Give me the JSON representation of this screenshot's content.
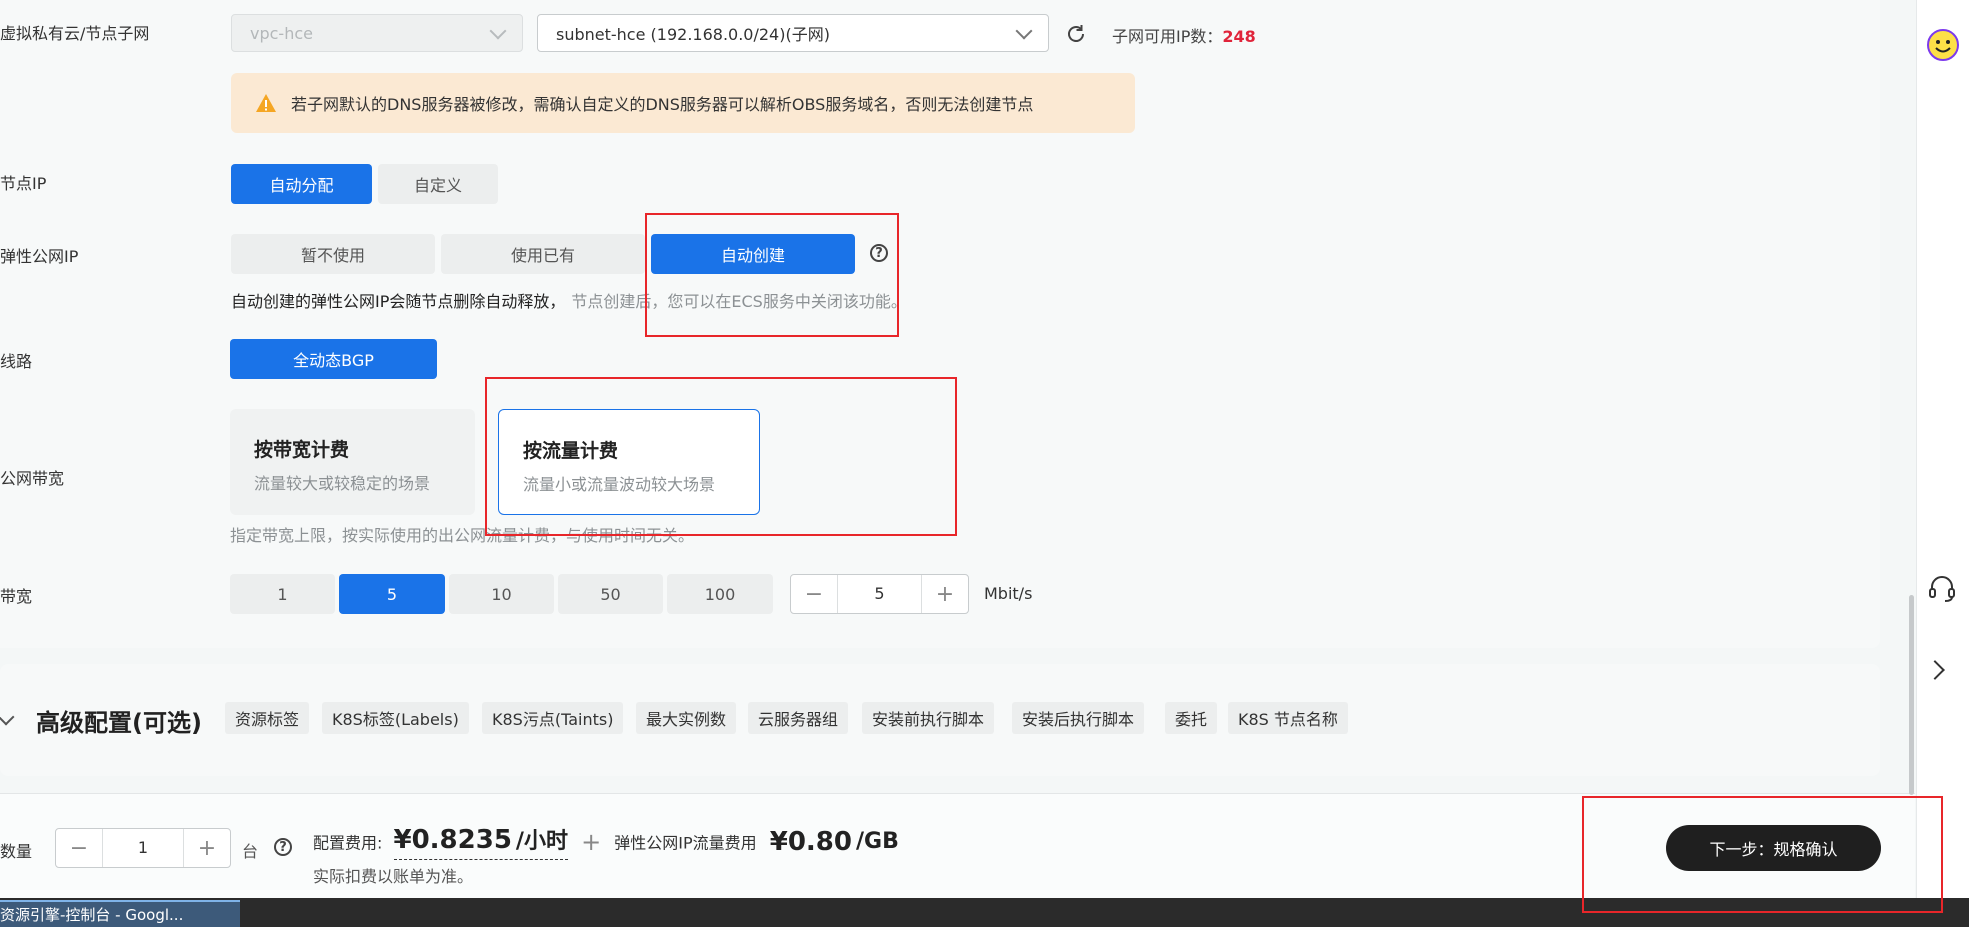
{
  "vpc": {
    "label": "虚拟私有云/节点子网",
    "vpc_value": "vpc-hce",
    "subnet_value": "subnet-hce (192.168.0.0/24)(子网)",
    "available_ip_label": "子网可用IP数：",
    "available_ip_count": "248"
  },
  "dns_warning": "若子网默认的DNS服务器被修改，需确认自定义的DNS服务器可以解析OBS服务域名，否则无法创建节点",
  "node_ip": {
    "label": "节点IP",
    "options": [
      "自动分配",
      "自定义"
    ],
    "selected": "自动分配"
  },
  "eip": {
    "label": "弹性公网IP",
    "options": [
      "暂不使用",
      "使用已有",
      "自动创建"
    ],
    "selected": "自动创建",
    "note_bold": "自动创建的弹性公网IP会随节点删除自动释放，",
    "note_rest": "节点创建后，您可以在ECS服务中关闭该功能。"
  },
  "line": {
    "label": "线路",
    "value": "全动态BGP"
  },
  "billing": {
    "label": "公网带宽",
    "cards": [
      {
        "title": "按带宽计费",
        "desc": "流量较大或较稳定的场景"
      },
      {
        "title": "按流量计费",
        "desc": "流量小或流量波动较大场景"
      }
    ],
    "selected_index": 1,
    "note": "指定带宽上限，按实际使用的出公网流量计费，与使用时间无关。"
  },
  "bandwidth": {
    "label": "带宽",
    "options": [
      "1",
      "5",
      "10",
      "50",
      "100"
    ],
    "selected": "5",
    "value": "5",
    "unit": "Mbit/s"
  },
  "advanced": {
    "title": "高级配置(可选)",
    "tags": [
      "资源标签",
      "K8S标签(Labels)",
      "K8S污点(Taints)",
      "最大实例数",
      "云服务器组",
      "安装前执行脚本",
      "安装后执行脚本",
      "委托",
      "K8S 节点名称"
    ]
  },
  "footer": {
    "quantity_label": "数量",
    "quantity": "1",
    "unit": "台",
    "config_fee_label": "配置费用:",
    "config_fee": "¥0.8235",
    "config_fee_unit": "/小时",
    "plus": "+",
    "eip_fee_label": "弹性公网IP流量费用",
    "eip_fee": "¥0.80",
    "eip_fee_unit": "/GB",
    "note": "实际扣费以账单为准。",
    "next_button": "下一步：规格确认"
  },
  "taskbar": {
    "item": "资源引擎-控制台 - Googl..."
  },
  "colors": {
    "primary": "#1a73e8",
    "warning_bg": "#fbe9d3",
    "warning_icon": "#f5a623",
    "red_count": "#e0243a",
    "dark_button": "#1f1f1f",
    "annotation_red": "#e8262a"
  }
}
